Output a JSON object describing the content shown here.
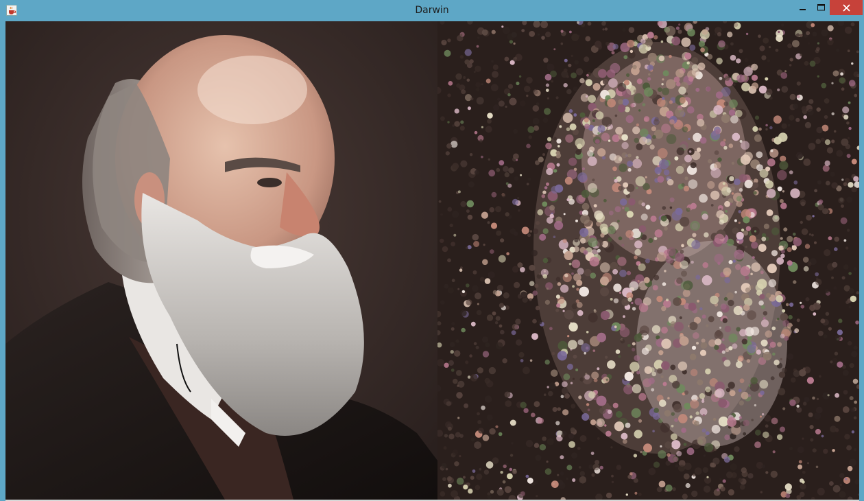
{
  "window": {
    "title": "Darwin",
    "icon": "java-cup-icon",
    "controls": {
      "minimize_icon": "minimize-icon",
      "maximize_icon": "maximize-icon",
      "close_icon": "close-icon"
    },
    "colors": {
      "titlebar": "#5ea7c6",
      "close": "#c7423a"
    }
  },
  "content": {
    "left_image": "portrait-photo",
    "right_image": "generated-circle-approximation"
  }
}
